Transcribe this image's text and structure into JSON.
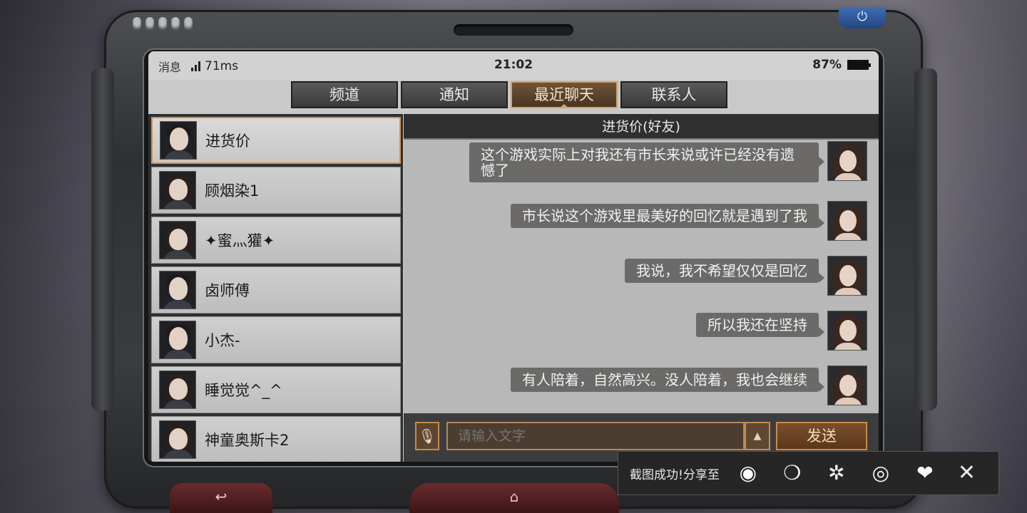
{
  "status_bar": {
    "app_label": "消息",
    "latency": "71ms",
    "time": "21:02",
    "battery": "87%"
  },
  "tabs": [
    {
      "label": "频道",
      "active": false
    },
    {
      "label": "通知",
      "active": false
    },
    {
      "label": "最近聊天",
      "active": true
    },
    {
      "label": "联系人",
      "active": false
    }
  ],
  "contacts": [
    {
      "name": "进货价",
      "selected": true,
      "gender": "m"
    },
    {
      "name": "顾烟染1",
      "selected": false,
      "gender": "f"
    },
    {
      "name": "✦蜜灬獾✦",
      "selected": false,
      "gender": "f"
    },
    {
      "name": "卤师傅",
      "selected": false,
      "gender": "m"
    },
    {
      "name": "小杰-",
      "selected": false,
      "gender": "m"
    },
    {
      "name": "睡觉觉^_^",
      "selected": false,
      "gender": "f"
    },
    {
      "name": "神童奥斯卡2",
      "selected": false,
      "gender": "f"
    }
  ],
  "chat": {
    "title": "进货价(好友)",
    "messages": [
      "这个游戏实际上对我还有市长来说或许已经没有遗憾了",
      "市长说这个游戏里最美好的回忆就是遇到了我",
      "我说，我不希望仅仅是回忆",
      "所以我还在坚持",
      "有人陪着，自然高兴。没人陪着，我也会继续"
    ],
    "input_placeholder": "请输入文字",
    "send_label": "发送"
  },
  "share": {
    "text": "截图成功!分享至",
    "targets": [
      "weibo-icon",
      "wechat-icon",
      "moments-icon",
      "qq-icon",
      "qzone-icon"
    ]
  },
  "colors": {
    "accent": "#d8a162",
    "bubble": "#6b6a68",
    "panel": "#2e2f30"
  }
}
